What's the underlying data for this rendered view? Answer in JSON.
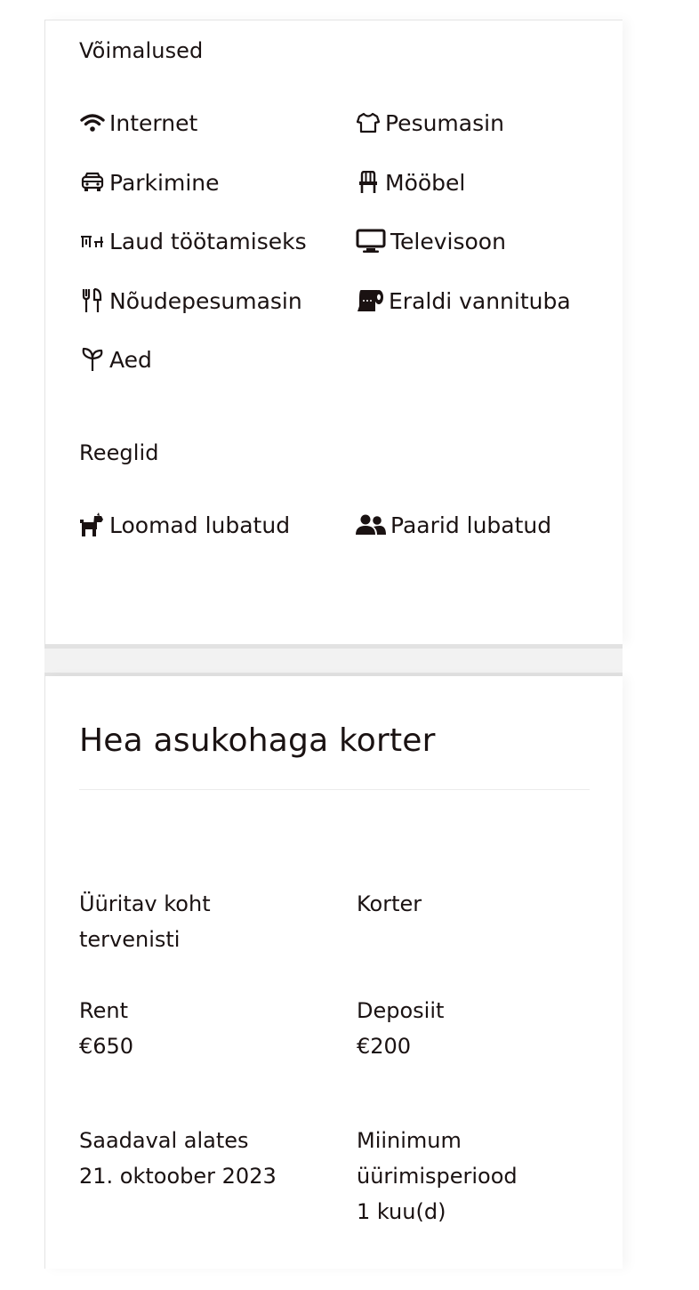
{
  "amenities": {
    "title": "Võimalused",
    "items": [
      {
        "label": "Internet",
        "icon": "wifi-icon"
      },
      {
        "label": "Pesumasin",
        "icon": "shirt-icon"
      },
      {
        "label": "Parkimine",
        "icon": "car-icon"
      },
      {
        "label": "Mööbel",
        "icon": "chair-icon"
      },
      {
        "label": "Laud töötamiseks",
        "icon": "desk-icon"
      },
      {
        "label": "Televisoon",
        "icon": "tv-icon"
      },
      {
        "label": "Nõudepesumasin",
        "icon": "utensils-icon"
      },
      {
        "label": "Eraldi vannituba",
        "icon": "toilet-paper-icon"
      },
      {
        "label": "Aed",
        "icon": "sprout-icon"
      }
    ]
  },
  "rules": {
    "title": "Reeglid",
    "items": [
      {
        "label": "Loomad lubatud",
        "icon": "dog-icon"
      },
      {
        "label": "Paarid lubatud",
        "icon": "users-icon"
      }
    ]
  },
  "listing": {
    "title": "Hea asukohaga korter",
    "type_label": "Üüritav koht tervenisti",
    "type_value": "Korter",
    "rent_label": "Rent",
    "rent_value": "€650",
    "deposit_label": "Deposiit",
    "deposit_value": "€200",
    "available_label": "Saadaval alates",
    "available_value": "21. oktoober 2023",
    "min_period_label": "Miinimum üürimisperiood",
    "min_period_value": "1 kuu(d)"
  }
}
